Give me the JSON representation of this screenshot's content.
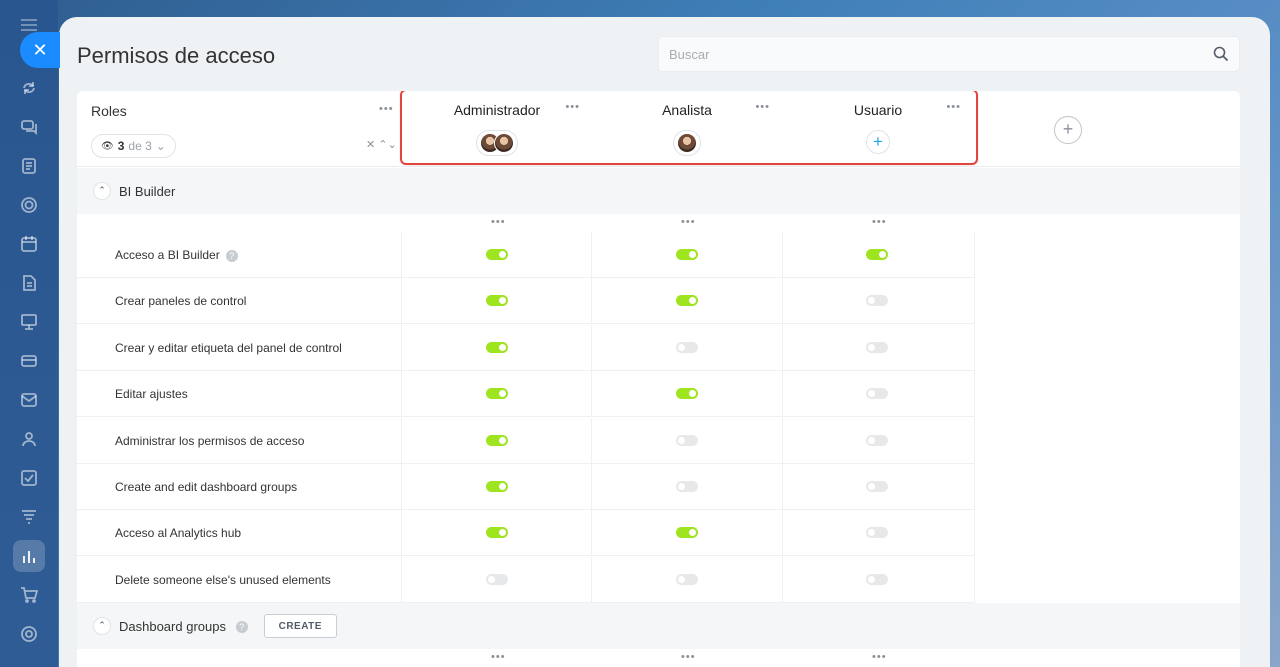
{
  "page": {
    "title": "Permisos de acceso"
  },
  "search": {
    "placeholder": "Buscar"
  },
  "rail": {
    "items": [
      {
        "icon": "recycle-icon"
      },
      {
        "icon": "chat-icon"
      },
      {
        "icon": "document-icon"
      },
      {
        "icon": "circle-icon"
      },
      {
        "icon": "calendar-icon"
      },
      {
        "icon": "file-icon"
      },
      {
        "icon": "presentation-icon"
      },
      {
        "icon": "card-icon"
      },
      {
        "icon": "mail-icon"
      },
      {
        "icon": "users-icon"
      },
      {
        "icon": "checkbox-icon"
      },
      {
        "icon": "filter-funnel-icon"
      },
      {
        "icon": "bar-chart-icon",
        "active": true
      },
      {
        "icon": "cart-icon"
      },
      {
        "icon": "settings-icon"
      }
    ]
  },
  "roles_header": {
    "title": "Roles",
    "filter_count": "3",
    "filter_suffix": "de 3"
  },
  "roles": [
    {
      "name": "Administrador",
      "avatars": 2
    },
    {
      "name": "Analista",
      "avatars": 1
    },
    {
      "name": "Usuario",
      "avatars": 0
    }
  ],
  "sections": [
    {
      "title": "BI Builder",
      "permissions": [
        {
          "label": "Acceso a BI Builder",
          "help": true,
          "values": [
            true,
            true,
            true
          ]
        },
        {
          "label": "Crear paneles de control",
          "values": [
            true,
            true,
            false
          ]
        },
        {
          "label": "Crear y editar etiqueta del panel de control",
          "values": [
            true,
            false,
            false
          ]
        },
        {
          "label": "Editar ajustes",
          "values": [
            true,
            true,
            false
          ]
        },
        {
          "label": "Administrar los permisos de acceso",
          "values": [
            true,
            false,
            false
          ]
        },
        {
          "label": "Create and edit dashboard groups",
          "values": [
            true,
            false,
            false
          ]
        },
        {
          "label": "Acceso al Analytics hub",
          "values": [
            true,
            true,
            false
          ]
        },
        {
          "label": "Delete someone else's unused elements",
          "values": [
            false,
            false,
            false
          ]
        }
      ]
    },
    {
      "title": "Dashboard groups",
      "help": true,
      "button": "CREATE"
    }
  ],
  "colors": {
    "toggle_on": "#9ee41f",
    "toggle_off": "#e6e8ea",
    "highlight": "#e2453f",
    "accent": "#1a8cff"
  }
}
